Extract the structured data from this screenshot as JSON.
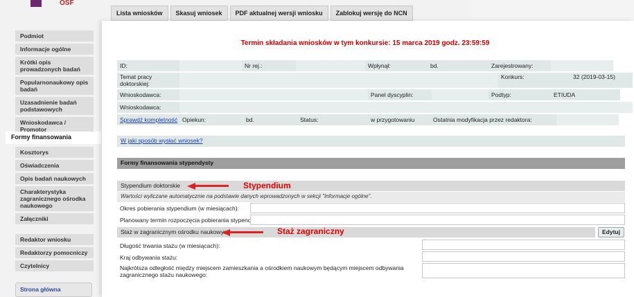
{
  "brand": {
    "logo_text": "OSF",
    "color": "#6b2a6e"
  },
  "tabs": [
    {
      "label": "Lista wniosków"
    },
    {
      "label": "Skasuj wniosek"
    },
    {
      "label": "PDF aktualnej wersji wniosku"
    },
    {
      "label": "Zablokuj wersję do NCN"
    }
  ],
  "sidebar": {
    "items": [
      {
        "label": "Podmiot"
      },
      {
        "label": "Informacje ogólne"
      },
      {
        "label": "Krótki opis prowadzonych badań"
      },
      {
        "label": "Popularnonaukowy opis badań"
      },
      {
        "label": "Uzasadnienie badań podstawowych"
      },
      {
        "label": "Wnioskodawca / Promotor"
      }
    ],
    "active": "Formy finansowania",
    "items2": [
      {
        "label": "Kosztorys"
      },
      {
        "label": "Oświadczenia"
      },
      {
        "label": "Opis badań naukowych"
      },
      {
        "label": "Charakterystyka zagranicznego ośrodka naukowego"
      },
      {
        "label": "Załączniki"
      }
    ],
    "items3": [
      {
        "label": "Redaktor wniosku"
      },
      {
        "label": "Redaktorzy pomocniczy"
      },
      {
        "label": "Czytelnicy"
      }
    ],
    "home": "Strona główna"
  },
  "deadline": "Termin składania wniosków w tym konkursie: 15 marca 2019 godz. 23:59:59",
  "info": {
    "id_label": "ID:",
    "id_value": "",
    "nrrej_label": "Nr rej.:",
    "nrrej_value": "",
    "wplynal_label": "Wpłynął:",
    "wplynal_value": "bd.",
    "zarejestrowany_label": "Zarejestrowany:",
    "zarejestrowany_value": "",
    "temat_label": "Temat pracy doktorskiej:",
    "temat_value": "",
    "konkurs_label": "Konkurs:",
    "konkurs_value": "32 (2019-03-15)",
    "wnioskodawca_label": "Wnioskodawca:",
    "wnioskodawca_value": "",
    "panel_label": "Panel dyscyplin:",
    "panel_value": "",
    "podtyp_label": "Podtyp:",
    "podtyp_value": "ETIUDA",
    "wnioskodawca2_label": "Wnioskodawca:",
    "wnioskodawca2_value": "",
    "kompletnosc_link": "Sprawdź kompletność",
    "opiekun_label": "Opiekun:",
    "opiekun_value": "bd.",
    "status_label": "Status:",
    "status_value": "w przygotowaniu",
    "modyfikacja_label": "Ostatnia modyfikacja przez redaktora:",
    "modyfikacja_value": ""
  },
  "howto_link": "W jaki sposób wysłać wniosek?",
  "section_title": "Formy finansowania stypendysty",
  "stypendium": {
    "header": "Stypendium doktorskie",
    "note": "Wartości wyliczane automatycznie na podstawie danych wprowadzonych w sekcji \"Informacje ogólne\".",
    "fields": [
      {
        "label": "Okres pobierania stypendium (w miesiącach):",
        "value": ""
      },
      {
        "label": "Planowany termin rozpoczęcia pobierania stypendium:",
        "value": ""
      }
    ],
    "annotation": "Stypendium"
  },
  "staz": {
    "header": "Staż w zagranicznym ośrodku naukowym",
    "edit_label": "Edytuj",
    "fields": [
      {
        "label": "Długość trwania stażu (w miesiącach):",
        "value": ""
      },
      {
        "label": "Kraj odbywania stażu:",
        "value": ""
      },
      {
        "label": "Najkrótsza odległość między miejscem zamieszkania a ośrodkiem naukowym będącym miejscem odbywania zagranicznego stażu naukowego:",
        "value": ""
      }
    ],
    "annotation": "Staż zagraniczny"
  },
  "colors": {
    "deadline": "#d00000",
    "annotation": "#e60000",
    "cell_bg": "#dfe7e7"
  }
}
